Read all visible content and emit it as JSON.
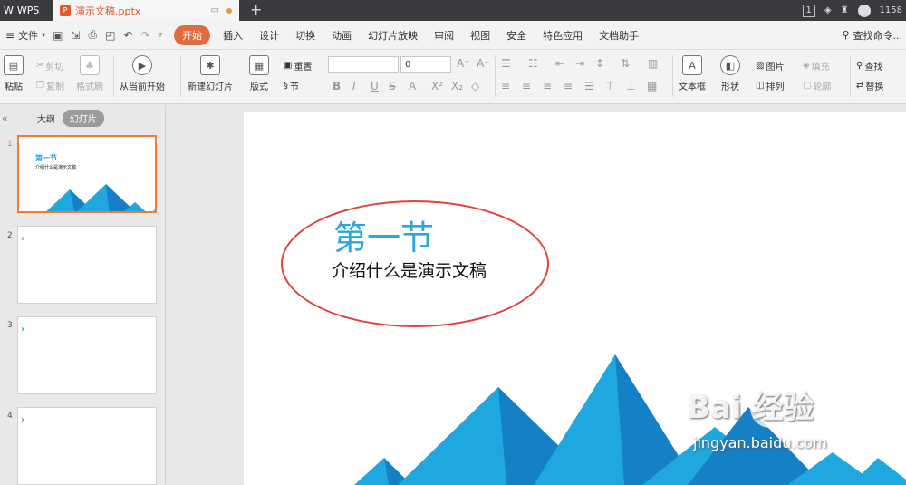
{
  "app": {
    "name": "WPS",
    "doc_title": "演示文稿.pptx",
    "user_id": "1158"
  },
  "titlebar": {
    "badge": "1"
  },
  "menu": {
    "file": "文件",
    "tabs": [
      "开始",
      "插入",
      "设计",
      "切换",
      "动画",
      "幻灯片放映",
      "审阅",
      "视图",
      "安全",
      "特色应用",
      "文档助手"
    ],
    "active": "开始",
    "search": "查找命令..."
  },
  "ribbon": {
    "paste": "粘贴",
    "cut": "剪切",
    "copy": "复制",
    "format_painter": "格式刷",
    "play_from_current": "从当前开始",
    "new_slide": "新建幻灯片",
    "layout": "版式",
    "reset": "重置",
    "section": "节",
    "font_size": "0",
    "textbox": "文本框",
    "shape": "形状",
    "picture": "图片",
    "fill": "填充",
    "arrange": "排列",
    "outline": "轮廓",
    "find": "查找",
    "replace": "替换"
  },
  "panel": {
    "tab_outline": "大纲",
    "tab_slides": "幻灯片",
    "slide_numbers": [
      "1",
      "2",
      "3",
      "4"
    ],
    "thumb_title": "第一节",
    "thumb_sub": "介绍什么是演示文稿"
  },
  "slide": {
    "title": "第一节",
    "subtitle": "介绍什么是演示文稿"
  },
  "watermark": {
    "brand": "Bai 经验",
    "url": "jingyan.baidu.com"
  },
  "colors": {
    "accent": "#e26a3d",
    "title_blue": "#2aa6dc",
    "annotation_red": "#e23f3f",
    "mountain_light": "#1fa8e0",
    "mountain_dark": "#1680c7"
  }
}
